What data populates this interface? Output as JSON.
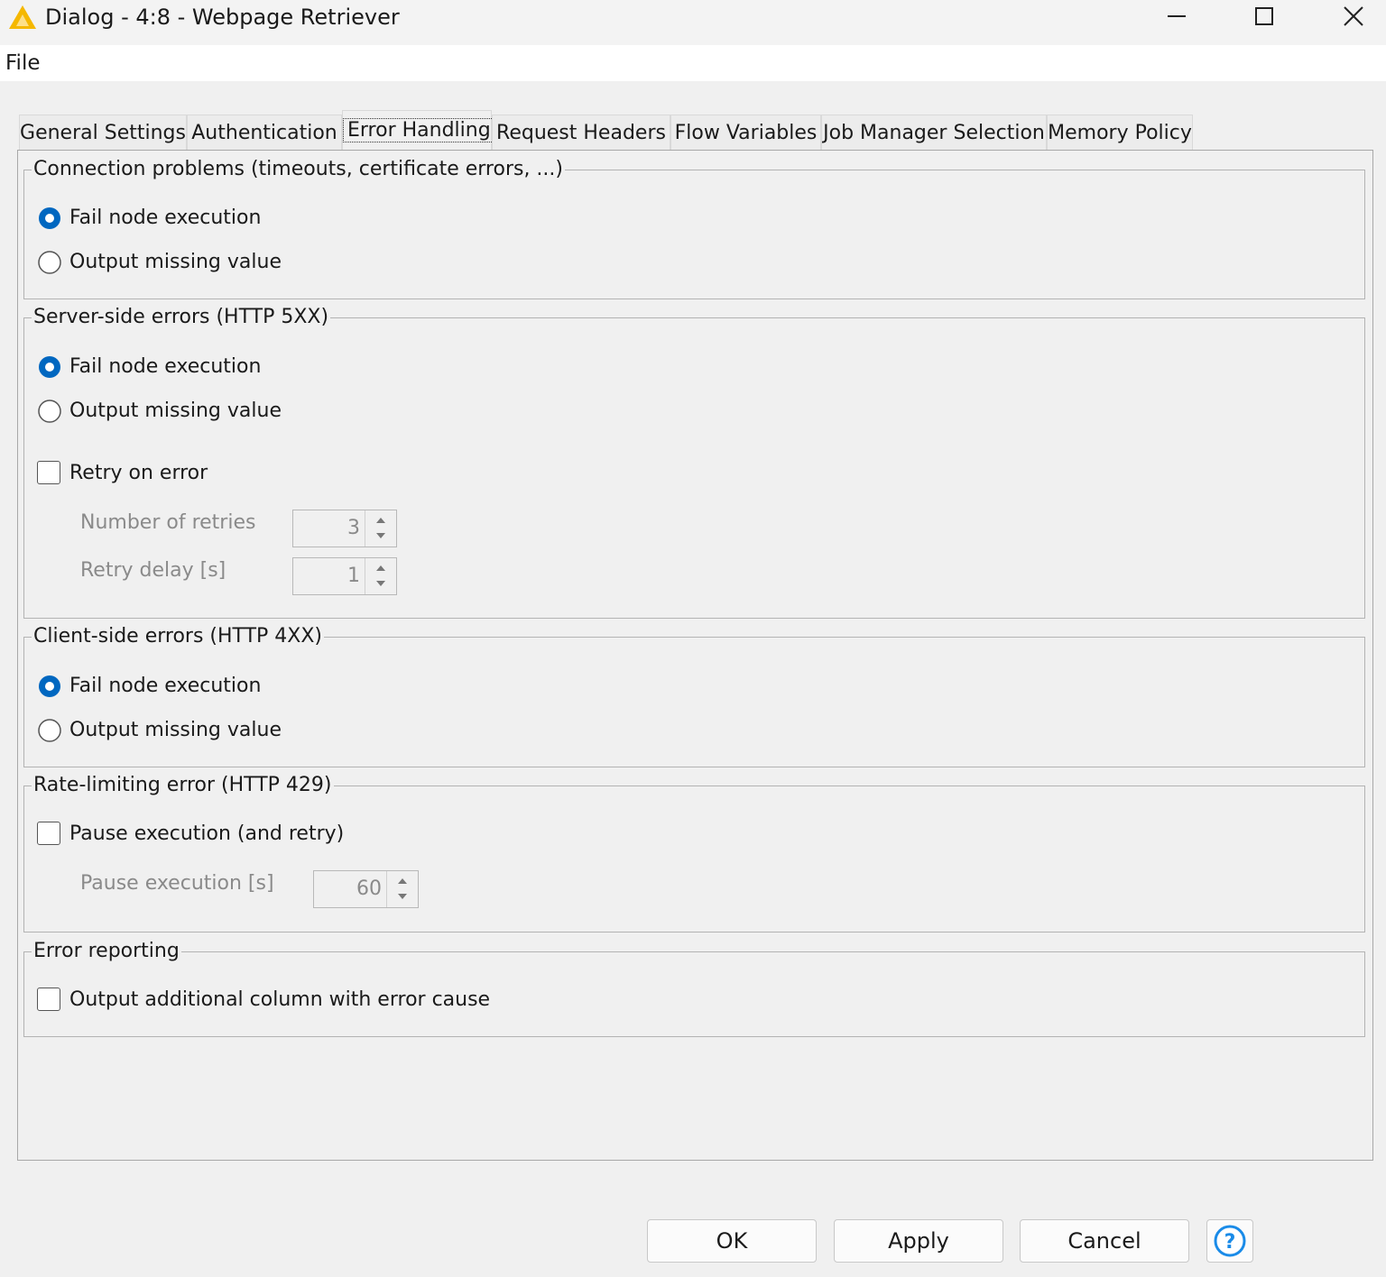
{
  "window": {
    "title": "Dialog - 4:8 - Webpage Retriever"
  },
  "menu": {
    "file": "File"
  },
  "tabs": [
    {
      "label": "General Settings"
    },
    {
      "label": "Authentication"
    },
    {
      "label": "Error Handling",
      "active": true
    },
    {
      "label": "Request Headers"
    },
    {
      "label": "Flow Variables"
    },
    {
      "label": "Job Manager Selection"
    },
    {
      "label": "Memory Policy"
    }
  ],
  "groups": {
    "connection": {
      "legend": "Connection problems (timeouts, certificate errors, ...)",
      "options": [
        "Fail node execution",
        "Output missing value"
      ],
      "selected": 0
    },
    "server": {
      "legend": "Server-side errors (HTTP 5XX)",
      "options": [
        "Fail node execution",
        "Output missing value"
      ],
      "selected": 0,
      "retry_label": "Retry on error",
      "retry_checked": false,
      "retries_label": "Number of retries",
      "retries_value": "3",
      "delay_label": "Retry delay [s]",
      "delay_value": "1"
    },
    "client": {
      "legend": "Client-side errors (HTTP 4XX)",
      "options": [
        "Fail node execution",
        "Output missing value"
      ],
      "selected": 0
    },
    "rate": {
      "legend": "Rate-limiting error (HTTP 429)",
      "pause_label": "Pause execution (and retry)",
      "pause_checked": false,
      "pause_seconds_label": "Pause execution [s]",
      "pause_seconds_value": "60"
    },
    "reporting": {
      "legend": "Error reporting",
      "column_label": "Output additional column with error cause",
      "column_checked": false
    }
  },
  "buttons": {
    "ok": "OK",
    "apply": "Apply",
    "cancel": "Cancel"
  },
  "colors": {
    "accent": "#0067c0",
    "warning_icon": "#f5b800"
  }
}
